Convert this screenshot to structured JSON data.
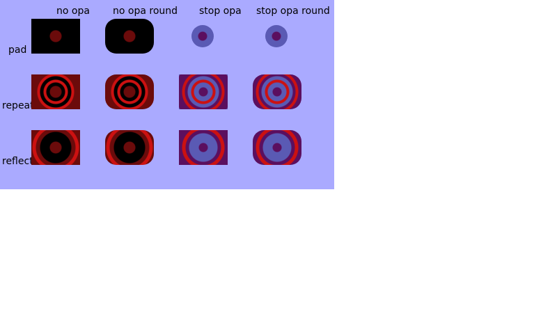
{
  "columns": [
    "no opa",
    "no opa round",
    "stop opa",
    "stop opa round"
  ],
  "rows": [
    "pad",
    "repeat",
    "reflect"
  ],
  "colors": {
    "background": "#aaaaff",
    "black": "#000000",
    "dark_red": "#6b0b0b",
    "red": "#cc1111",
    "purple": "#5b0f5f",
    "periwinkle": "#5a5ab4"
  }
}
